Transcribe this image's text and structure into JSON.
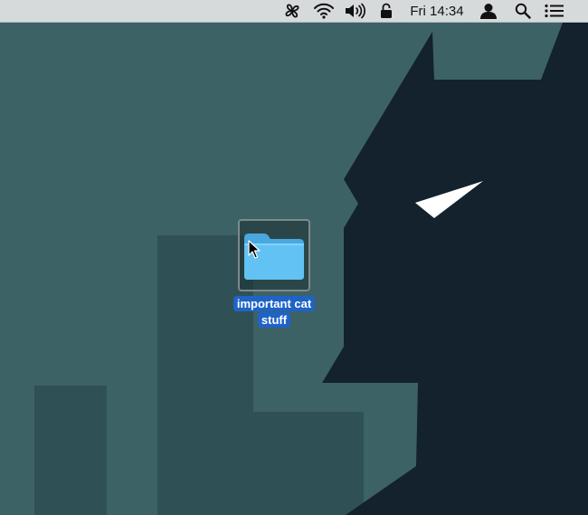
{
  "menubar": {
    "clock": "Fri 14:34",
    "icons": [
      "fan-icon",
      "wifi-icon",
      "volume-icon",
      "lock-icon",
      "user-icon",
      "search-icon",
      "notification-list-icon"
    ]
  },
  "desktop": {
    "folder": {
      "label": "important cat stuff",
      "icon": "folder-icon",
      "selected": true
    }
  },
  "colors": {
    "wallpaper_base": "#3d6266",
    "wallpaper_mid": "#2f5155",
    "silhouette": "#13222c",
    "selection": "#1f63c7",
    "menubar": "#d6dadb",
    "folder": "#62c2f3"
  }
}
